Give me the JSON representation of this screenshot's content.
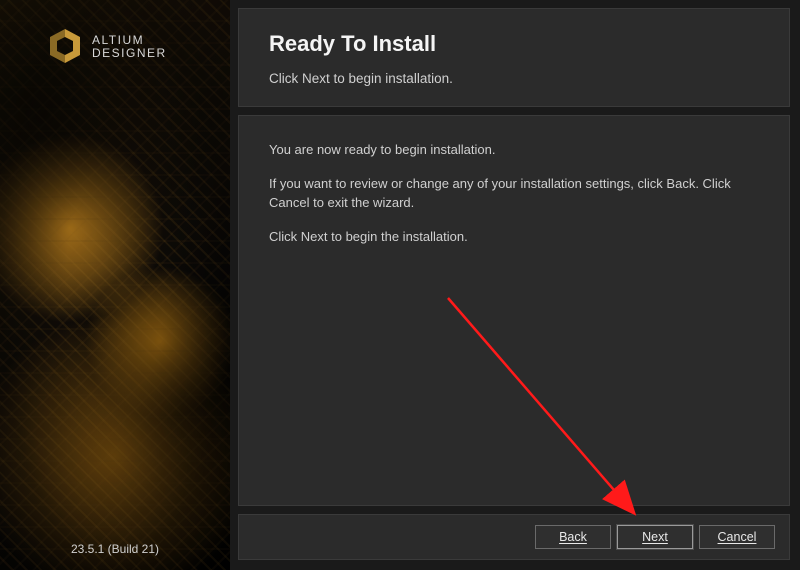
{
  "brand": {
    "line1": "ALTIUM",
    "line2": "DESIGNER"
  },
  "version": "23.5.1 (Build 21)",
  "header": {
    "title": "Ready To Install",
    "subtitle": "Click Next to begin installation."
  },
  "body": {
    "p1": "You are now ready to begin installation.",
    "p2": "If you want to review or change any of your installation settings, click Back. Click Cancel to exit the wizard.",
    "p3": "Click Next to begin the installation."
  },
  "buttons": {
    "back": "Back",
    "next": "Next",
    "cancel": "Cancel"
  }
}
